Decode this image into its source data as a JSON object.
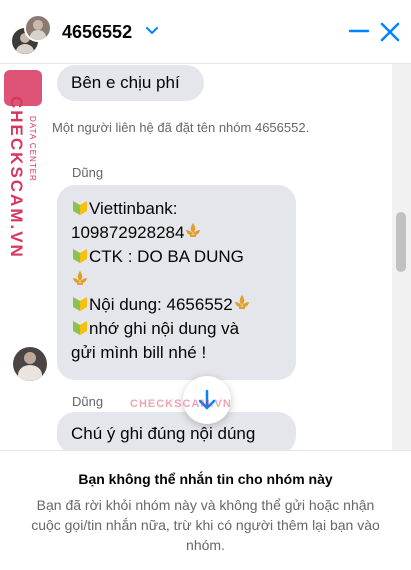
{
  "header": {
    "title": "4656552",
    "caret_icon": "chevron-down-icon",
    "minimize_icon": "minimize-icon",
    "close_icon": "close-icon",
    "accent": "#0084ff"
  },
  "thread": {
    "msg1": "Bên e chịu phí",
    "system_msg": "Một người liên hệ đã đặt tên nhóm 4656552.",
    "sender1": "Dũng",
    "msg2_lines": [
      "Viettinbank:",
      "109872928284",
      "CTK : DO BA DUNG",
      "",
      "Nội dung: 4656552",
      "nhớ ghi nội dung và",
      "gửi mình bill nhé !"
    ],
    "sender2": "Dũng",
    "msg3": "Chú ý ghi đúng nội dúng"
  },
  "watermark": {
    "side": "CHECKSCAM.VN",
    "side_small": "DATA CENTER",
    "center": "CHECKSCAM.VN"
  },
  "footer": {
    "title": "Bạn không thể nhắn tin cho nhóm này",
    "desc": "Bạn đã rời khỏi nhóm này và không thể gửi hoặc nhận cuộc gọi/tin nhắn nữa, trừ khi có người thêm lại bạn vào nhóm."
  }
}
